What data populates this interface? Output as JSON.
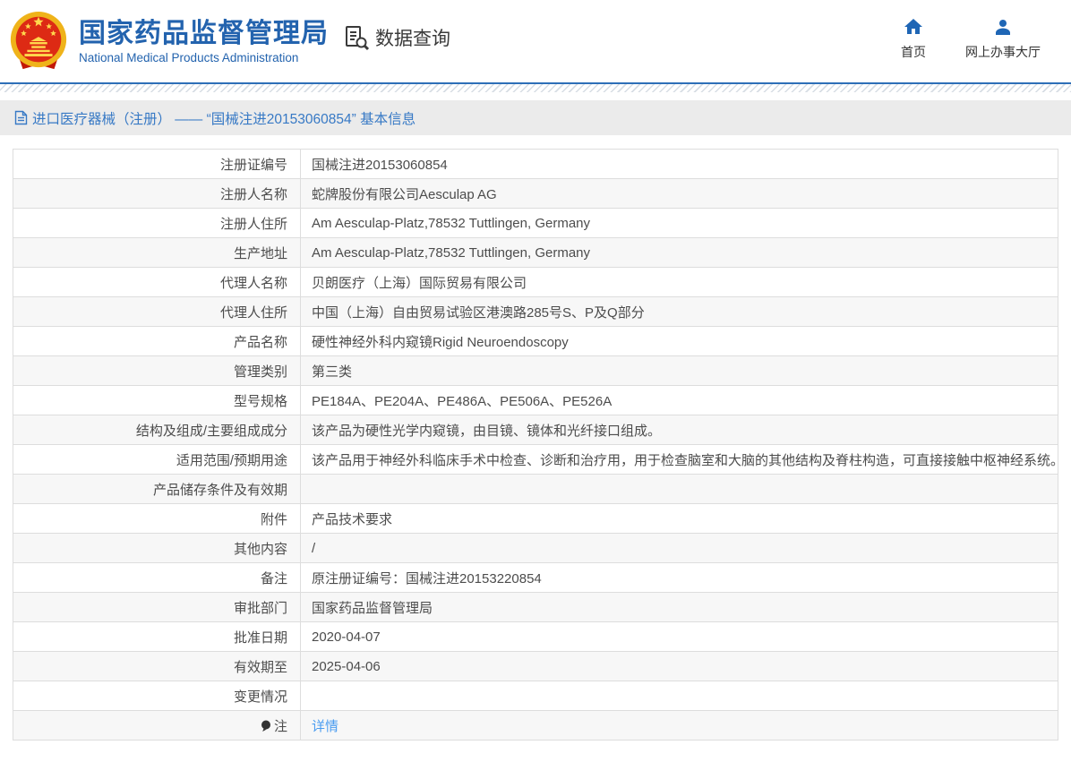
{
  "header": {
    "title": "国家药品监督管理局",
    "subtitle": "National Medical Products Administration",
    "data_query_label": "数据查询",
    "nav": [
      {
        "label": "首页",
        "icon": "home-icon"
      },
      {
        "label": "网上办事大厅",
        "icon": "user-icon"
      }
    ]
  },
  "breadcrumb": {
    "text": "进口医疗器械（注册） —— “国械注进20153060854” 基本信息",
    "icon": "document-icon"
  },
  "colors": {
    "brand_blue": "#2363ae",
    "breadcrumb_blue": "#3779c5",
    "link_blue": "#4a9cf0",
    "divider_blue": "#2d6fb7",
    "row_alt_gray": "#f7f7f7",
    "bar_gray": "#ebebeb"
  },
  "table": {
    "rows": [
      {
        "label": "注册证编号",
        "value": "国械注进20153060854"
      },
      {
        "label": "注册人名称",
        "value": "蛇牌股份有限公司Aesculap AG"
      },
      {
        "label": "注册人住所",
        "value": "Am Aesculap-Platz,78532 Tuttlingen, Germany"
      },
      {
        "label": "生产地址",
        "value": "Am Aesculap-Platz,78532 Tuttlingen, Germany"
      },
      {
        "label": "代理人名称",
        "value": "贝朗医疗（上海）国际贸易有限公司"
      },
      {
        "label": "代理人住所",
        "value": "中国（上海）自由贸易试验区港澳路285号S、P及Q部分"
      },
      {
        "label": "产品名称",
        "value": "硬性神经外科内窥镜Rigid Neuroendoscopy"
      },
      {
        "label": "管理类别",
        "value": "第三类"
      },
      {
        "label": "型号规格",
        "value": "PE184A、PE204A、PE486A、PE506A、PE526A"
      },
      {
        "label": "结构及组成/主要组成成分",
        "value": "该产品为硬性光学内窥镜，由目镜、镜体和光纤接口组成。"
      },
      {
        "label": "适用范围/预期用途",
        "value": "该产品用于神经外科临床手术中检查、诊断和治疗用，用于检查脑室和大脑的其他结构及脊柱构造，可直接接触中枢神经系统。"
      },
      {
        "label": "产品储存条件及有效期",
        "value": ""
      },
      {
        "label": "附件",
        "value": "产品技术要求"
      },
      {
        "label": "其他内容",
        "value": "/"
      },
      {
        "label": "备注",
        "value": "原注册证编号：国械注进20153220854"
      },
      {
        "label": "审批部门",
        "value": "国家药品监督管理局"
      },
      {
        "label": "批准日期",
        "value": "2020-04-07"
      },
      {
        "label": "有效期至",
        "value": "2025-04-06"
      },
      {
        "label": "变更情况",
        "value": ""
      },
      {
        "label": "注",
        "value": "详情"
      }
    ]
  }
}
